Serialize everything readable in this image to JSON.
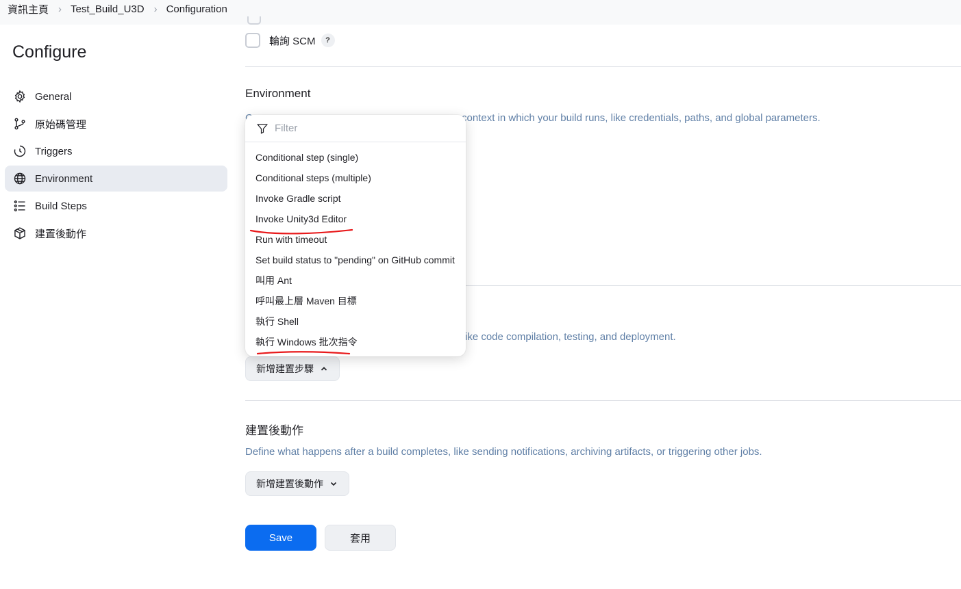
{
  "breadcrumb": {
    "home": "資訊主頁",
    "job": "Test_Build_U3D",
    "current": "Configuration"
  },
  "sidebar": {
    "title": "Configure",
    "items": [
      {
        "label": "General",
        "icon": "gear-icon"
      },
      {
        "label": "原始碼管理",
        "icon": "branch-icon"
      },
      {
        "label": "Triggers",
        "icon": "timer-icon"
      },
      {
        "label": "Environment",
        "icon": "globe-icon",
        "active": true
      },
      {
        "label": "Build Steps",
        "icon": "list-icon"
      },
      {
        "label": "建置後動作",
        "icon": "package-icon"
      }
    ]
  },
  "triggers": {
    "poll_scm_label": "輪詢 SCM",
    "help_label": "?"
  },
  "environment": {
    "title": "Environment",
    "description_start": "C",
    "description_end": "context in which your build runs, like credentials, paths, and global parameters."
  },
  "build_steps": {
    "description_end": "ike code compilation, testing, and deployment.",
    "add_button_label": "新增建置步驟"
  },
  "post_build": {
    "title": "建置後動作",
    "description": "Define what happens after a build completes, like sending notifications, archiving artifacts, or triggering other jobs.",
    "add_button_label": "新增建置後動作"
  },
  "actions": {
    "save_label": "Save",
    "apply_label": "套用"
  },
  "dropdown": {
    "filter_placeholder": "Filter",
    "items": [
      "Conditional step (single)",
      "Conditional steps (multiple)",
      "Invoke Gradle script",
      "Invoke Unity3d Editor",
      "Run with timeout",
      "Set build status to \"pending\" on GitHub commit",
      "叫用 Ant",
      "呼叫最上層 Maven 目標",
      "執行 Shell",
      "執行 Windows 批次指令"
    ]
  },
  "colors": {
    "accent": "#0b6cf0",
    "description_text": "#5f7fa6",
    "active_nav_bg": "#e8ebf1",
    "annotation_red": "#e8191b"
  }
}
